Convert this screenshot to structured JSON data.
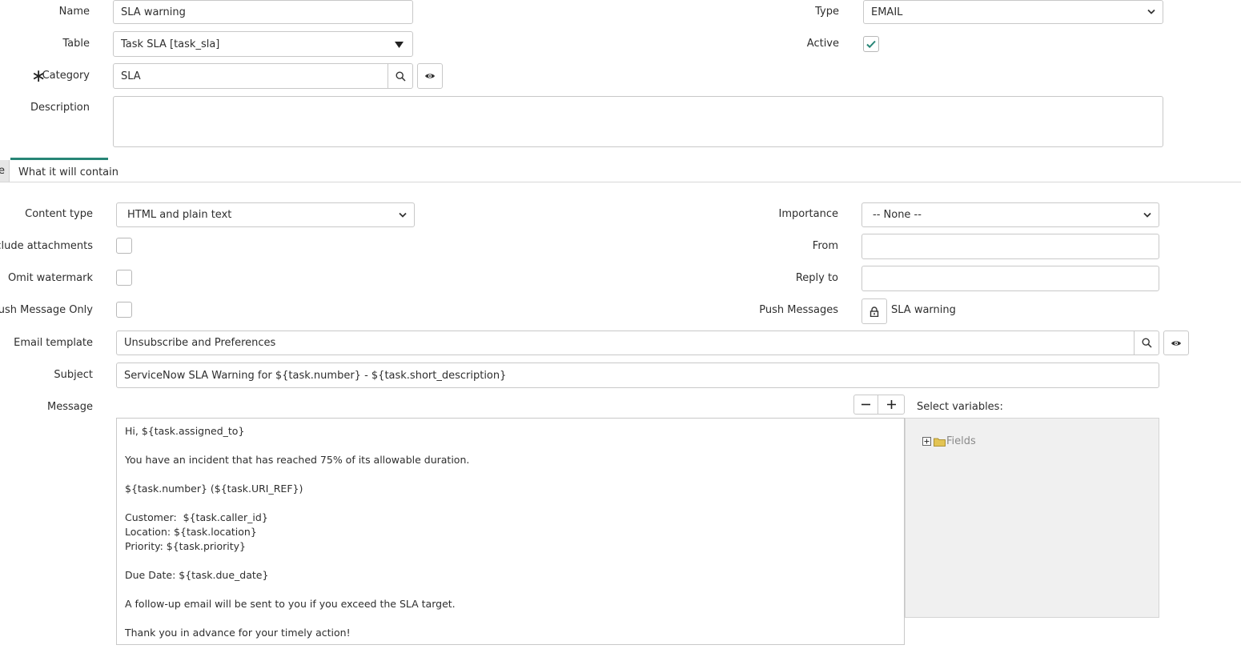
{
  "form": {
    "name_label": "Name",
    "name_value": "SLA warning",
    "type_label": "Type",
    "type_value": "EMAIL",
    "table_label": "Table",
    "table_value": "Task SLA [task_sla]",
    "active_label": "Active",
    "active_checked": true,
    "category_required": "∗",
    "category_label": "Category",
    "category_value": "SLA",
    "description_label": "Description",
    "description_value": ""
  },
  "tabs": {
    "partial_tab": "e",
    "active_tab": "What it will contain"
  },
  "content": {
    "content_type_label": "Content type",
    "content_type_value": "HTML and plain text",
    "importance_label": "Importance",
    "importance_value": "-- None --",
    "include_attachments_label": "Include attachments",
    "from_label": "From",
    "from_value": "",
    "omit_watermark_label": "Omit watermark",
    "reply_to_label": "Reply to",
    "reply_to_value": "",
    "push_message_only_label": "Push Message Only",
    "push_messages_label": "Push Messages",
    "push_messages_value": "SLA warning",
    "email_template_label": "Email template",
    "email_template_value": "Unsubscribe and Preferences",
    "subject_label": "Subject",
    "subject_value": "ServiceNow SLA Warning for ${task.number} - ${task.short_description}",
    "message_label": "Message",
    "select_variables_label": "Select variables:",
    "fields_tree_label": "Fields",
    "message_lines": [
      "Hi, ${task.assigned_to}",
      "",
      "You have an incident that has reached 75% of its allowable duration.",
      "",
      "${task.number} (${task.URI_REF})",
      "",
      "Customer:  ${task.caller_id}",
      "Location: ${task.location}",
      "Priority: ${task.priority}",
      "",
      "Due Date: ${task.due_date}",
      "",
      "A follow-up email will be sent to you if you exceed the SLA target.",
      "",
      "Thank you in advance for your timely action!"
    ]
  },
  "colors": {
    "accent": "#278576",
    "folder": "#e3c454",
    "tree_text": "#8a8a8a"
  }
}
